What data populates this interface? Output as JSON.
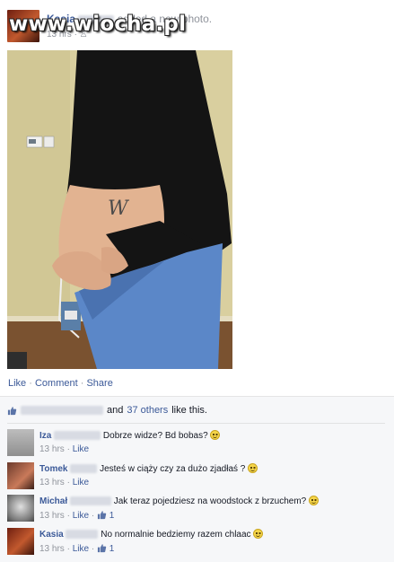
{
  "post": {
    "author_name": "Kasia",
    "action_text": "added a new photo.",
    "time": "13 hrs",
    "watermark": "www.wiocha.pl",
    "actions": {
      "like": "Like",
      "comment": "Comment",
      "share": "Share"
    }
  },
  "likes": {
    "and_text": "and",
    "others_link": "37 others",
    "suffix": "like this."
  },
  "comments": [
    {
      "name": "Iza",
      "text": "Dobrze widze? Bd bobas?",
      "time": "13 hrs",
      "like": "Like",
      "count": ""
    },
    {
      "name": "Tomek",
      "text": "Jesteś w ciąży czy za dużo zjadłaś ?",
      "time": "13 hrs",
      "like": "Like",
      "count": ""
    },
    {
      "name": "Michał",
      "text": "Jak teraz pojedziesz na woodstock z brzuchem?",
      "time": "13 hrs",
      "like": "Like",
      "count": "1"
    },
    {
      "name": "Kasia",
      "text": "No normalnie bedziemy razem chlaac",
      "time": "13 hrs",
      "like": "Like",
      "count": "1"
    }
  ],
  "colors": {
    "link": "#3b5998",
    "meta": "#90949c",
    "feedback_bg": "#f6f7f9"
  }
}
